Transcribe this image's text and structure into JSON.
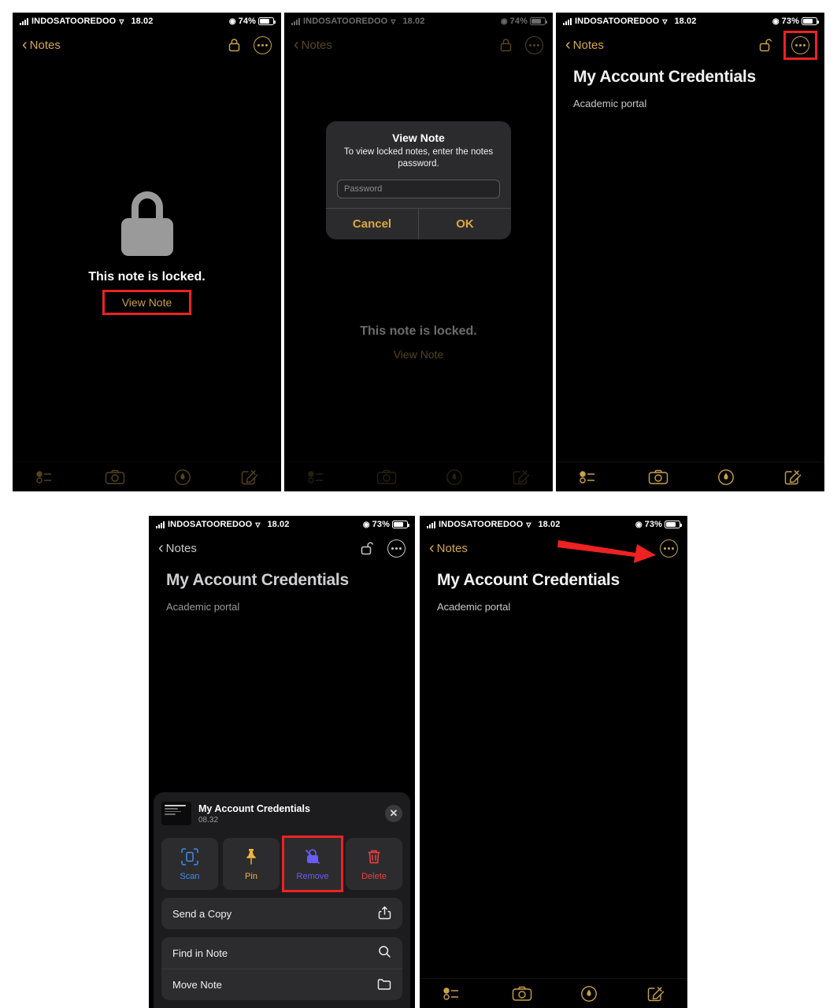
{
  "meta": {
    "accent_gold": "#c9a14a",
    "highlight_red": "#ee2222",
    "bg_black": "#000000",
    "sheet_gray": "#2c2c2e"
  },
  "status_bar": {
    "carrier": "INDOSATOOREDOO",
    "time": "18.02",
    "battery_74": "74%",
    "battery_73": "73%",
    "wifi_icon": "wifi-icon",
    "signal_icon": "signal-bars-icon",
    "battery_icon": "battery-icon",
    "eye_icon": "eye-icon"
  },
  "nav": {
    "back_label": "Notes",
    "back_icon": "chevron-left-icon",
    "lock_icon": "lock-closed-icon",
    "unlock_icon": "lock-open-icon",
    "more_icon": "ellipsis-circle-icon"
  },
  "toolbar": {
    "checklist_icon": "checklist-icon",
    "camera_icon": "camera-icon",
    "markup_icon": "markup-pen-icon",
    "compose_icon": "compose-icon"
  },
  "note": {
    "title": "My Account Credentials",
    "body": "Academic portal",
    "timestamp": "08.32"
  },
  "locked": {
    "lock_icon": "padlock-icon",
    "message": "This note is locked.",
    "view_note": "View Note"
  },
  "alert": {
    "title": "View Note",
    "message": "To view locked notes, enter the notes password.",
    "password_placeholder": "Password",
    "cancel": "Cancel",
    "ok": "OK"
  },
  "sheet": {
    "close_icon": "close-x-icon",
    "actions": [
      {
        "label": "Scan",
        "icon": "scan-document-icon",
        "color": "#3d8cf0"
      },
      {
        "label": "Pin",
        "icon": "pin-icon",
        "color": "#f0b43d"
      },
      {
        "label": "Remove",
        "icon": "lock-slash-icon",
        "color": "#6a5cf5"
      },
      {
        "label": "Delete",
        "icon": "trash-icon",
        "color": "#f03d3d"
      }
    ],
    "groups": [
      {
        "rows": [
          {
            "label": "Send a Copy",
            "icon": "share-icon"
          }
        ]
      },
      {
        "rows": [
          {
            "label": "Find in Note",
            "icon": "search-icon"
          },
          {
            "label": "Move Note",
            "icon": "folder-icon"
          }
        ]
      }
    ]
  },
  "annotations": {
    "panel1_highlight": "view-note-button",
    "panel3_highlight": "more-button",
    "panel4_highlight": "remove-lock-action",
    "panel5_arrow": "arrow-pointing-to-more-button"
  }
}
